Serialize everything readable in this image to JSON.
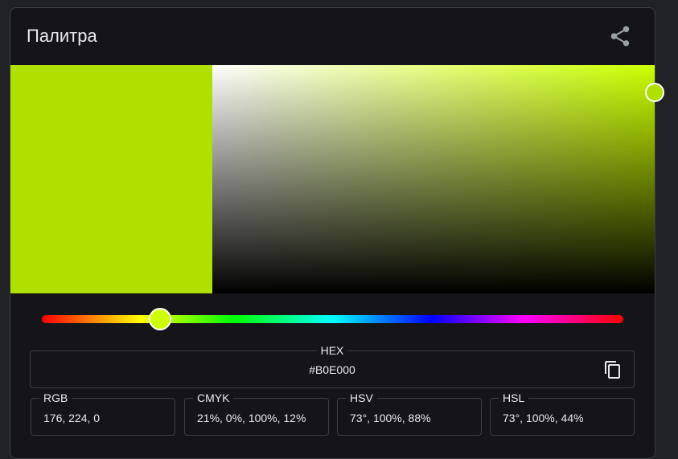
{
  "header": {
    "title": "Палитра",
    "share_icon": "share-icon"
  },
  "color": {
    "hex_color": "#B0E000",
    "hue_color": "#CCFF00",
    "hue_degrees": 73,
    "saturation": 1.0,
    "value": 0.88
  },
  "fields": {
    "hex": {
      "label": "HEX",
      "value": "#B0E000",
      "copy_icon": "copy-icon"
    },
    "rgb": {
      "label": "RGB",
      "value": "176, 224, 0"
    },
    "cmyk": {
      "label": "CMYK",
      "value": "21%, 0%, 100%, 12%"
    },
    "hsv": {
      "label": "HSV",
      "value": "73°, 100%, 88%"
    },
    "hsl": {
      "label": "HSL",
      "value": "73°, 100%, 44%"
    }
  }
}
